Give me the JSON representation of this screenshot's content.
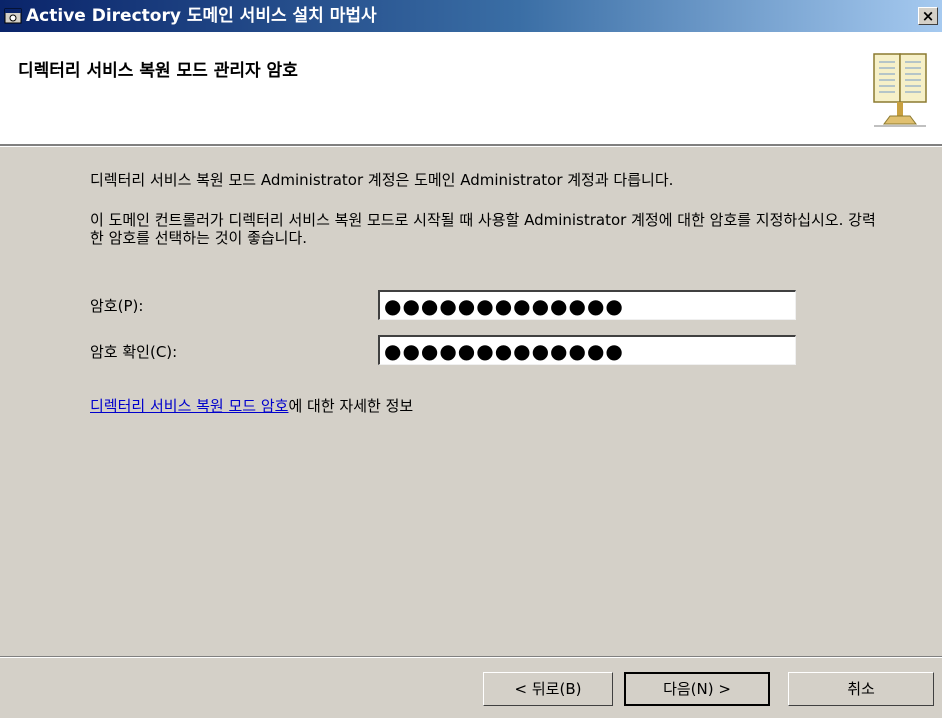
{
  "window": {
    "title": "Active Directory 도메인 서비스 설치 마법사",
    "close_label": "×"
  },
  "header": {
    "title": "디렉터리 서비스 복원 모드 관리자 암호"
  },
  "content": {
    "description1": "디렉터리 서비스 복원 모드 Administrator 계정은 도메인 Administrator 계정과 다릅니다.",
    "description2": "이 도메인 컨트롤러가 디렉터리 서비스 복원 모드로 시작될 때 사용할 Administrator 계정에 대한 암호를 지정하십시오. 강력한 암호를 선택하는 것이 좋습니다.",
    "password_label": "암호(P):",
    "password_value": "●●●●●●●●●●●●●",
    "confirm_label": "암호 확인(C):",
    "confirm_value": "●●●●●●●●●●●●●",
    "link_text": "디렉터리 서비스 복원 모드 암호",
    "link_suffix": "에 대한 자세한 정보"
  },
  "buttons": {
    "back": "< 뒤로(B)",
    "next": "다음(N) >",
    "cancel": "취소"
  },
  "colors": {
    "titlebar_start": "#0a246a",
    "titlebar_end": "#a6caf0",
    "dialog_bg": "#d4d0c8",
    "link": "#0000cc"
  },
  "icons": {
    "title_icon": "wizard-window-icon",
    "header_icon": "book-icon"
  }
}
